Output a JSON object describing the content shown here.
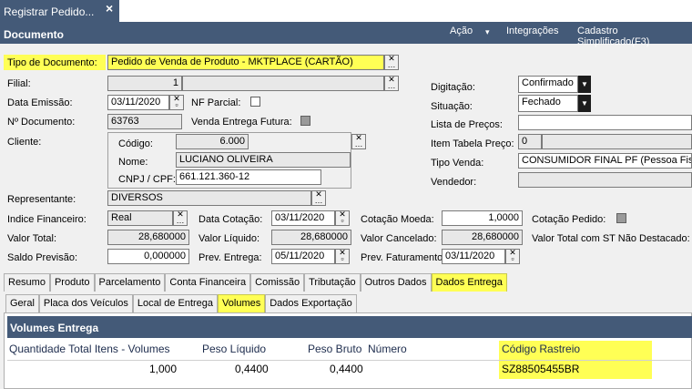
{
  "window_tab": {
    "title": "Registrar Pedido...",
    "close": "×"
  },
  "header": {
    "title": "Documento",
    "menu": [
      {
        "label": "Ação"
      },
      {
        "label": "▾"
      },
      {
        "label": "Integrações"
      },
      {
        "label": "Cadastro Simplificado(F3)"
      }
    ]
  },
  "form": {
    "tipo_documento": {
      "label": "Tipo de Documento:",
      "value": "Pedido de Venda de Produto - MKTPLACE (CARTÃO)"
    },
    "filial": {
      "label": "Filial:",
      "value": "1"
    },
    "data_emissao": {
      "label": "Data Emissão:",
      "value": "03/11/2020"
    },
    "nf_parcial": {
      "label": "NF Parcial:"
    },
    "n_documento": {
      "label": "Nº Documento:",
      "value": "63763"
    },
    "venda_entrega_futura": {
      "label": "Venda Entrega Futura:"
    },
    "cliente": {
      "label": "Cliente:",
      "codigo_label": "Código:",
      "codigo": "6.000",
      "nome_label": "Nome:",
      "nome": "LUCIANO OLIVEIRA",
      "cnpj_label": "CNPJ / CPF:",
      "cnpj": "661.121.360-12"
    },
    "digitacao": {
      "label": "Digitação:",
      "value": "Confirmado"
    },
    "situacao": {
      "label": "Situação:",
      "value": "Fechado"
    },
    "lista_precos": {
      "label": "Lista de Preços:",
      "value": ""
    },
    "item_tabela_preco": {
      "label": "Item Tabela Preço:",
      "value": "0"
    },
    "tipo_venda": {
      "label": "Tipo Venda:",
      "value": "CONSUMIDOR FINAL PF (Pessoa Fisica)"
    },
    "vendedor": {
      "label": "Vendedor:",
      "value": ""
    },
    "representante": {
      "label": "Representante:",
      "value": "DIVERSOS"
    },
    "indice_financeiro": {
      "label": "Indice Financeiro:",
      "value": "Real"
    },
    "data_cotacao": {
      "label": "Data Cotação:",
      "value": "03/11/2020"
    },
    "cotacao_moeda": {
      "label": "Cotação Moeda:",
      "value": "1,0000"
    },
    "cotacao_pedido": {
      "label": "Cotação Pedido:"
    },
    "valor_total": {
      "label": "Valor Total:",
      "value": "28,680000"
    },
    "valor_liquido": {
      "label": "Valor Líquido:",
      "value": "28,680000"
    },
    "valor_cancelado": {
      "label": "Valor Cancelado:",
      "value": "28,680000"
    },
    "valor_total_st": {
      "label": "Valor Total com ST Não Destacado:"
    },
    "saldo_previsao": {
      "label": "Saldo Previsão:",
      "value": "0,000000"
    },
    "prev_entrega": {
      "label": "Prev. Entrega:",
      "value": "05/11/2020"
    },
    "prev_faturamento": {
      "label": "Prev. Faturamento:",
      "value": "03/11/2020"
    }
  },
  "tabs_main": [
    {
      "label": "Resumo"
    },
    {
      "label": "Produto"
    },
    {
      "label": "Parcelamento"
    },
    {
      "label": "Conta Financeira"
    },
    {
      "label": "Comissão"
    },
    {
      "label": "Tributação"
    },
    {
      "label": "Outros Dados"
    },
    {
      "label": "Dados Entrega"
    }
  ],
  "tabs_sub": [
    {
      "label": "Geral"
    },
    {
      "label": "Placa dos Veículos"
    },
    {
      "label": "Local de Entrega"
    },
    {
      "label": "Volumes"
    },
    {
      "label": "Dados Exportação"
    }
  ],
  "volumes": {
    "title": "Volumes Entrega",
    "columns": [
      "Quantidade Total Itens - Volumes",
      "Peso Líquido",
      "Peso Bruto",
      "Número",
      "Código Rastreio"
    ],
    "rows": [
      [
        "1,000",
        "0,4400",
        "0,4400",
        "",
        "SZ88505455BR"
      ]
    ]
  },
  "colors": {
    "header": "#445a78",
    "highlight": "#ffff55"
  }
}
